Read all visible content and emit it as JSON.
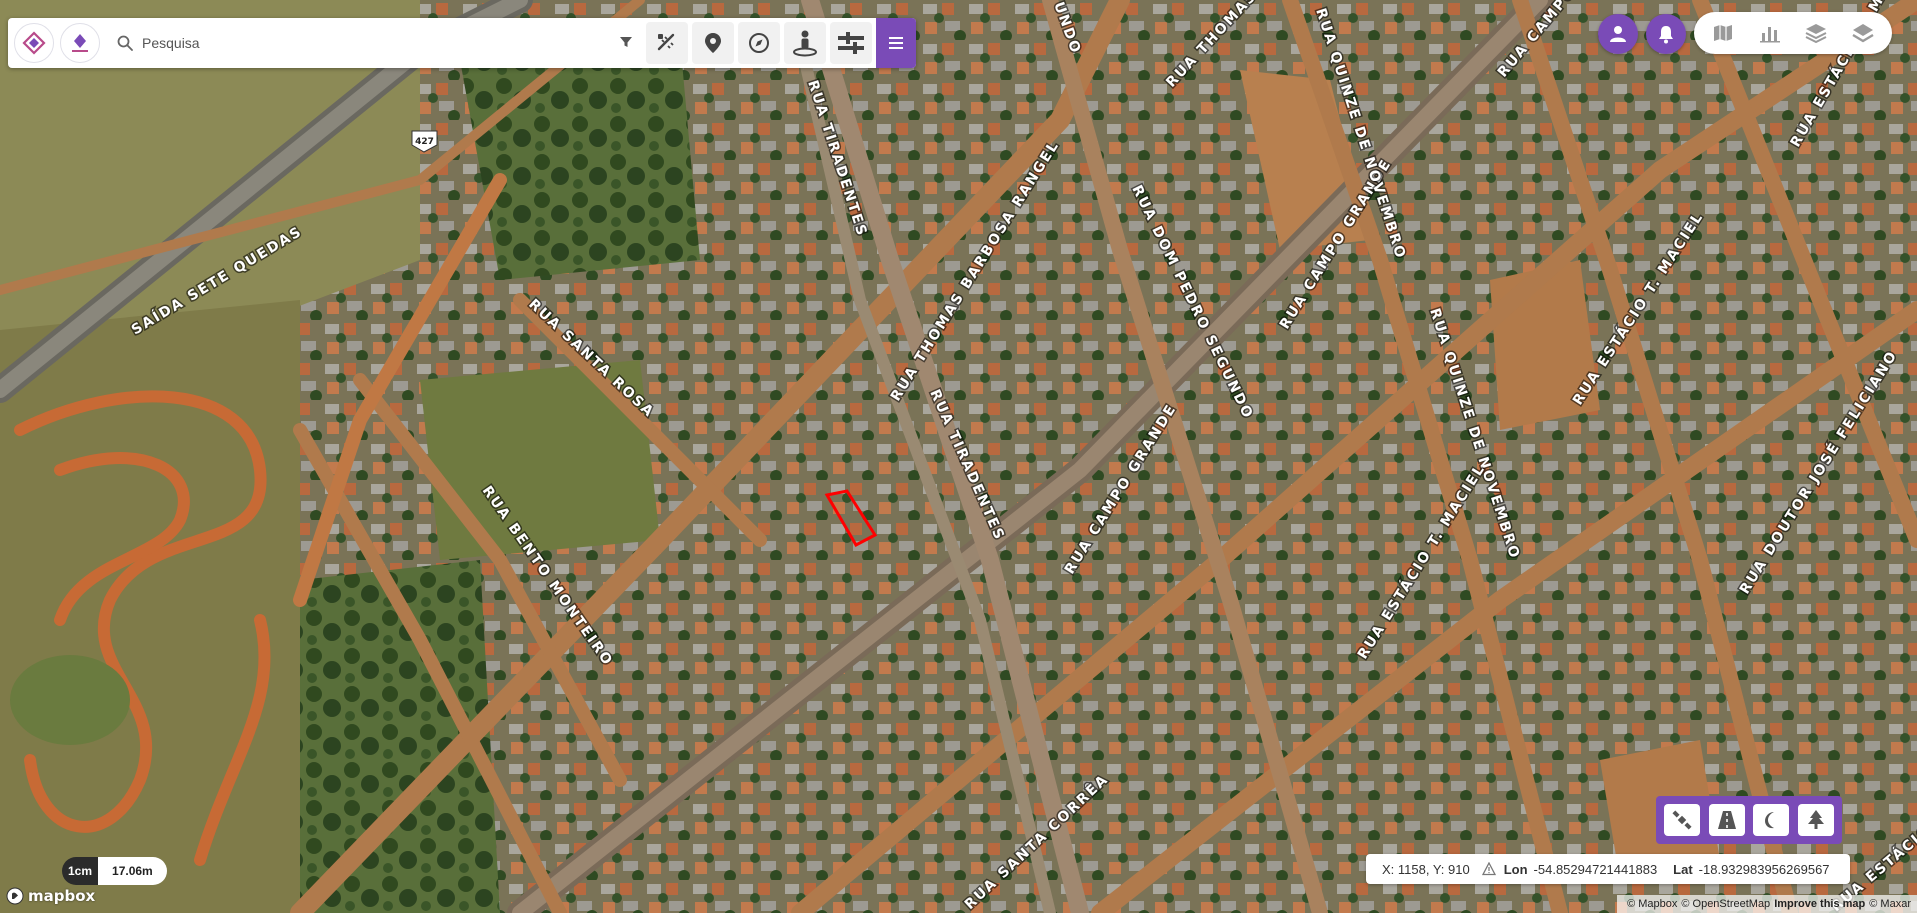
{
  "search": {
    "placeholder": "Pesquisa"
  },
  "toolbar": {
    "tools": [
      "measure-icon",
      "pin-icon",
      "compass-icon",
      "street-view-icon",
      "layers-sliders-icon"
    ],
    "menu_icon": "hamburger-icon"
  },
  "top_right": {
    "user_icon": "user-icon",
    "bell_icon": "bell-icon",
    "layer_buttons": [
      "map-icon",
      "bar-chart-icon",
      "stack-icon",
      "layers-icon"
    ]
  },
  "style_panel": {
    "buttons": [
      "satellite-icon",
      "road-icon",
      "moon-icon",
      "tree-icon"
    ]
  },
  "coords": {
    "xy": "X: 1158, Y: 910",
    "lon_label": "Lon",
    "lon_value": "-54.85294721441883",
    "lat_label": "Lat",
    "lat_value": "-18.932983956269567"
  },
  "scale": {
    "unit": "1cm",
    "distance": "17.06m"
  },
  "mapbox": {
    "label": "mapbox"
  },
  "attribution": {
    "mapbox": "© Mapbox",
    "osm": "© OpenStreetMap",
    "improve": "Improve this map",
    "maxar": "© Maxar"
  },
  "roads": [
    "SAÍDA SETE QUEDAS",
    "RUA SANTA ROSA",
    "RUA BENTO MONTEIRO",
    "RUA TIRADENTES",
    "RUA TIRADENTES",
    "RUA THOMAS BARBOSA RANGEL",
    "RUA THOMAS",
    "RUA DOM PEDRO SEGUNDO",
    "RUA CAMPO GRANDE",
    "RUA CAMPO GRANDE",
    "RUA CAMPO",
    "RUA QUINZE DE NOVEMBRO",
    "RUA QUINZE DE NOVEMBRO",
    "RUA ESTÁCIO T. MACIEL",
    "RUA ESTÁCIO T. MACIEL",
    "RUA ESTÁCIO T. MACIEL",
    "RUA DOUTOR JOSÉ FELICIANO",
    "RUA SANTA CORRÊA",
    "UNDO",
    "RUA ESTÁCIO"
  ],
  "highway_shield": "427"
}
